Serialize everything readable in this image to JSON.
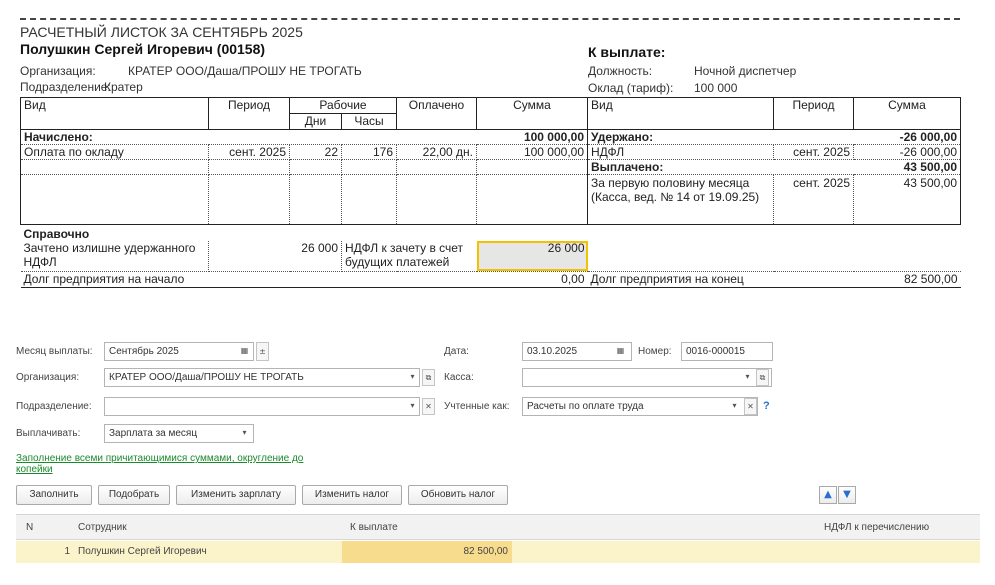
{
  "payslip": {
    "title": "РАСЧЕТНЫЙ ЛИСТОК ЗА СЕНТЯБРЬ 2025",
    "employee": "Полушкин Сергей Игоревич (00158)",
    "org_label": "Организация:",
    "org_value": "КРАТЕР ООО/Даша/ПРОШУ НЕ ТРОГАТЬ",
    "dept_label": "Подразделение:",
    "dept_value": "Кратер",
    "to_pay": "К выплате:",
    "position_label": "Должность:",
    "position_value": "Ночной диспетчер",
    "salary_label": "Оклад (тариф):",
    "salary_value": "100 000",
    "table": {
      "headers": {
        "type": "Вид",
        "period": "Период",
        "work": "Рабочие",
        "days": "Дни",
        "hours": "Часы",
        "paid": "Оплачено",
        "sum": "Сумма",
        "type2": "Вид",
        "period2": "Период",
        "sum2": "Сумма"
      },
      "accrued_label": "Начислено:",
      "accrued_total": "100 000,00",
      "withheld_label": "Удержано:",
      "withheld_total": "-26 000,00",
      "row1": {
        "type": "Оплата по окладу",
        "period": "сент. 2025",
        "days": "22",
        "hours": "176",
        "paid": "22,00 дн.",
        "sum": "100 000,00",
        "type2": "НДФЛ",
        "period2": "сент. 2025",
        "sum2": "-26 000,00"
      },
      "paid_out_label": "Выплачено:",
      "paid_out_total": "43 500,00",
      "row3": {
        "type2": "За первую половину месяца (Касса, вед. № 14 от 19.09.25)",
        "period2": "сент. 2025",
        "sum2": "43 500,00"
      },
      "reference_label": "Справочно",
      "ref_row": {
        "label": "Зачтено излишне удержанного НДФЛ",
        "value": "26 000",
        "label2": "НДФЛ к зачету в счет будущих платежей",
        "value2": "26 000"
      },
      "debt_start_label": "Долг предприятия на начало",
      "debt_start_value": "0,00",
      "debt_end_label": "Долг предприятия на конец",
      "debt_end_value": "82 500,00"
    }
  },
  "form": {
    "month_label": "Месяц выплаты:",
    "month_value": "Сентябрь 2025",
    "date_label": "Дата:",
    "date_value": "03.10.2025",
    "number_label": "Номер:",
    "number_value": "0016-000015",
    "org_label": "Организация:",
    "org_value": "КРАТЕР ООО/Даша/ПРОШУ НЕ ТРОГАТЬ",
    "cash_label": "Касса:",
    "cash_value": "",
    "dept_label": "Подразделение:",
    "dept_value": "",
    "accounted_label": "Учтенные как:",
    "accounted_value": "Расчеты по оплате труда",
    "pay_label": "Выплачивать:",
    "pay_value": "Зарплата за месяц",
    "fill_link": "Заполнение всеми причитающимися суммами, округление до копейки"
  },
  "toolbar": {
    "fill": "Заполнить",
    "select": "Подобрать",
    "change_salary": "Изменить зарплату",
    "change_tax": "Изменить налог",
    "update_tax": "Обновить налог"
  },
  "grid": {
    "headers": {
      "n": "N",
      "employee": "Сотрудник",
      "to_pay": "К выплате",
      "tax": "НДФЛ к перечислению"
    },
    "rows": [
      {
        "n": "1",
        "employee": "Полушкин Сергей Игоревич",
        "to_pay": "82 500,00",
        "tax": ""
      }
    ]
  },
  "colors": {
    "selected_row": "#fbf3c9",
    "to_pay_cell": "#f7dc8e",
    "link": "#1c8a2c",
    "accent_blue": "#2a6fd0",
    "selection_border": "#f2c200"
  },
  "icons": {
    "calendar": "calendar-icon",
    "spin": "spin-icon",
    "dropdown": "dropdown-icon",
    "open": "open-icon",
    "clear": "clear-icon",
    "help": "help-icon",
    "move_up": "arrow-up-icon",
    "move_down": "arrow-down-icon"
  }
}
